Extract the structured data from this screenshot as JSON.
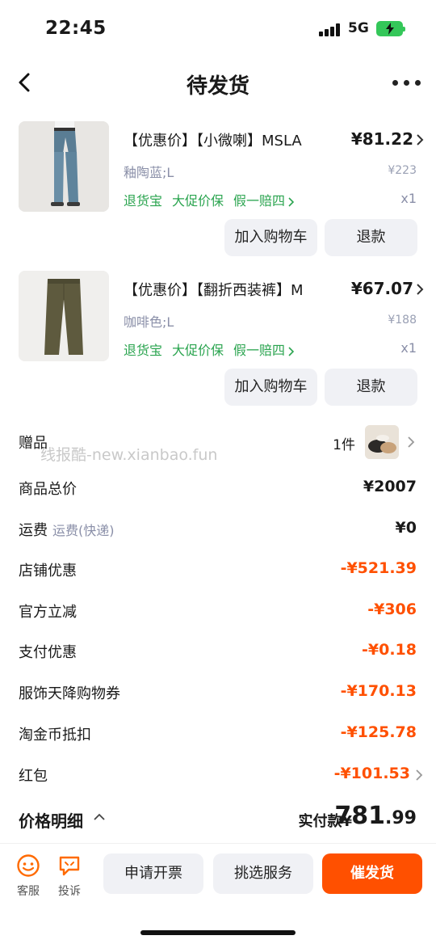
{
  "status": {
    "time": "22:45",
    "network": "5G"
  },
  "nav": {
    "title": "待发货"
  },
  "items": [
    {
      "title": "【优惠价】【小微喇】MSLA",
      "price": "¥81.22",
      "sku": "釉陶蓝;L",
      "original_price": "¥223",
      "tags": [
        "退货宝",
        "大促价保",
        "假一赔四"
      ],
      "qty": "x1",
      "add_cart_label": "加入购物车",
      "refund_label": "退款"
    },
    {
      "title": "【优惠价】【翻折西装裤】M",
      "price": "¥67.07",
      "sku": "咖啡色;L",
      "original_price": "¥188",
      "tags": [
        "退货宝",
        "大促价保",
        "假一赔四"
      ],
      "qty": "x1",
      "add_cart_label": "加入购物车",
      "refund_label": "退款"
    }
  ],
  "gift": {
    "label": "赠品",
    "count": "1件"
  },
  "watermark": "线报酷-new.xianbao.fun",
  "rows": [
    {
      "label": "商品总价",
      "sub": "",
      "value": "¥2007"
    },
    {
      "label": "运费",
      "sub": "运费(快递)",
      "value": "¥0"
    },
    {
      "label": "店铺优惠",
      "sub": "",
      "value": "-¥521.39"
    },
    {
      "label": "官方立减",
      "sub": "",
      "value": "-¥306"
    },
    {
      "label": "支付优惠",
      "sub": "",
      "value": "-¥0.18"
    },
    {
      "label": "服饰天降购物券",
      "sub": "",
      "value": "-¥170.13"
    },
    {
      "label": "淘金币抵扣",
      "sub": "",
      "value": "-¥125.78"
    },
    {
      "label": "红包",
      "sub": "",
      "value": "-¥101.53"
    }
  ],
  "summary": {
    "label": "价格明细",
    "pay_label": "实付款",
    "currency": "¥",
    "pay_int": "781",
    "pay_dec": ".99"
  },
  "bottom": {
    "service_label": "客服",
    "complain_label": "投诉",
    "invoice_label": "申请开票",
    "select_service_label": "挑选服务",
    "urge_label": "催发货"
  },
  "colors": {
    "accent": "#ff5000",
    "tag_green": "#2aa44f",
    "muted": "#8a8fa8"
  },
  "icons": [
    "back-icon",
    "more-icon",
    "chevron-right-icon",
    "chevron-up-icon",
    "customer-service-icon",
    "complaint-icon",
    "battery-icon",
    "signal-icon"
  ]
}
